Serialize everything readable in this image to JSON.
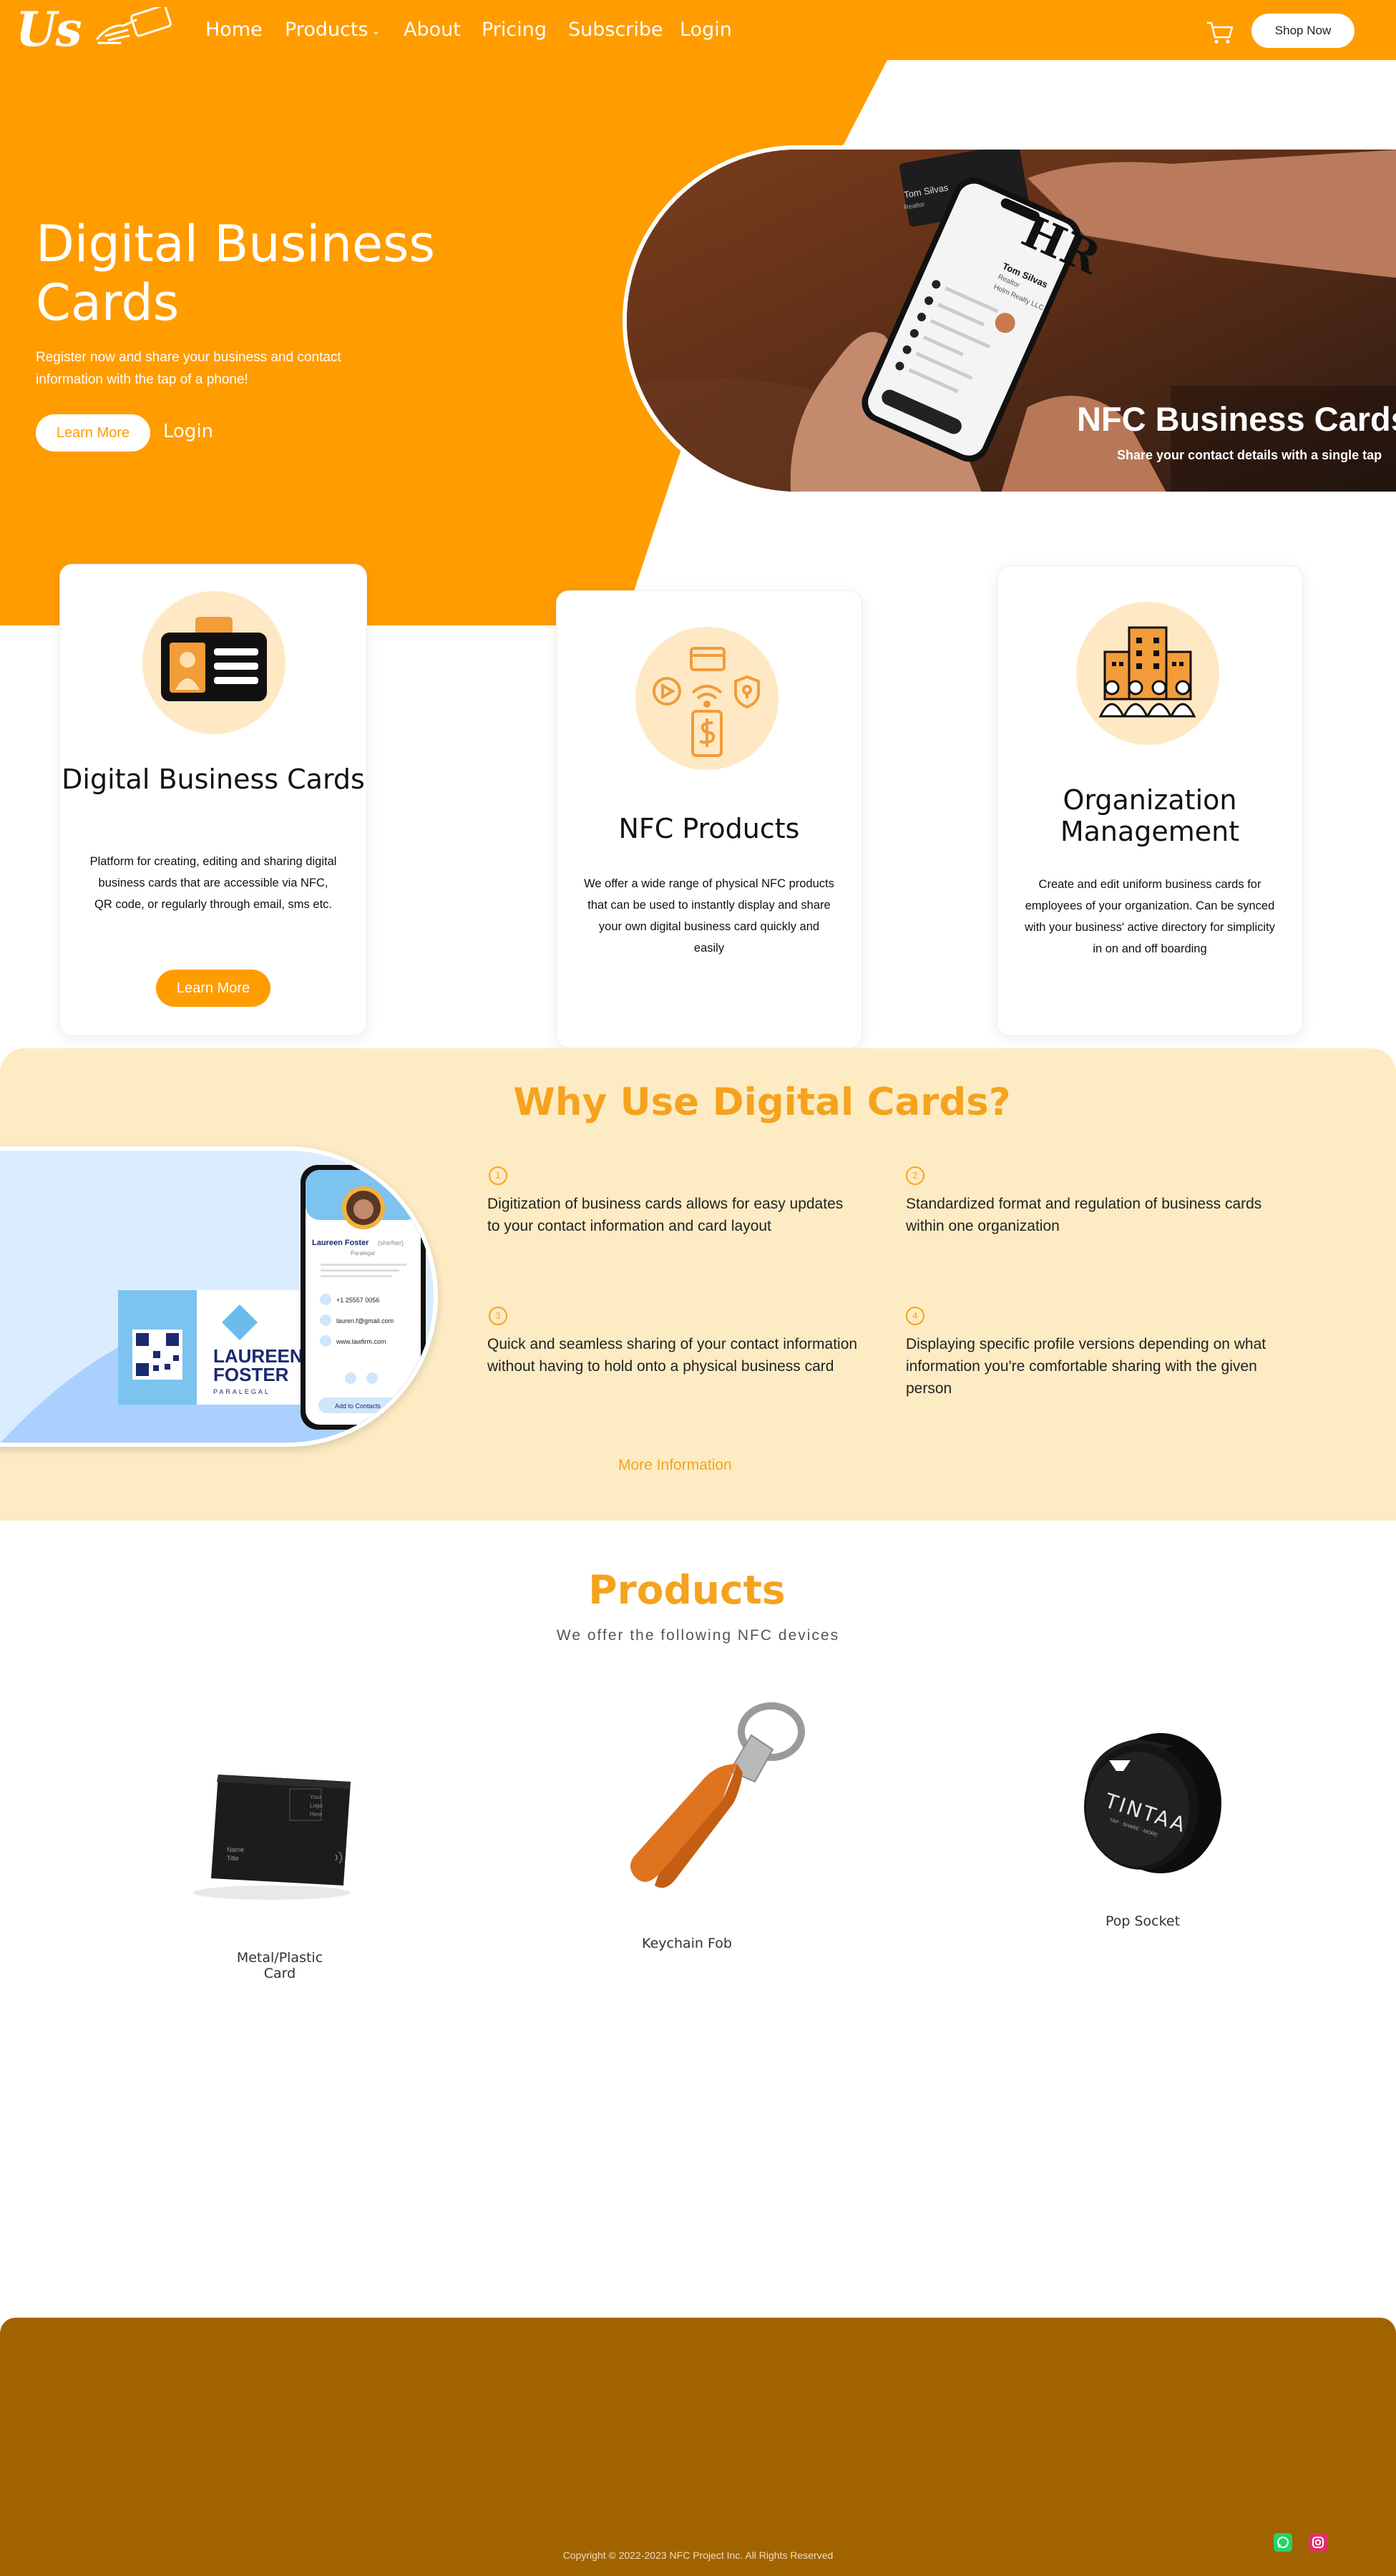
{
  "nav": {
    "logo_text": "Us",
    "links": [
      "Home",
      "Products",
      "About",
      "Pricing",
      "Subscribe",
      "Login"
    ],
    "products_chevron": "⌄",
    "shop_now": "Shop Now"
  },
  "hero": {
    "title": "Digital Business Cards",
    "subtitle": "Register now and share your business and contact information with the tap of a phone!",
    "learn_more": "Learn More",
    "login": "Login",
    "photo_caption": "NFC Business Cards",
    "photo_subcaption": "Share your contact details with a single tap",
    "phone_screen": {
      "monogram": "HR",
      "name": "Tom Silvas",
      "role": "Realtor",
      "company": "Holm Realty LLC",
      "card_name": "Tom Silvas",
      "card_role": "Realtor"
    }
  },
  "features": [
    {
      "icon": "id-badge-icon",
      "title": "Digital Business Cards",
      "description": "Platform for creating, editing and sharing digital business cards that are accessible via NFC, QR code, or regularly through email, sms etc.",
      "button": "Learn More"
    },
    {
      "icon": "nfc-products-icon",
      "title": "NFC Products",
      "description": "We offer a wide range of physical NFC products that can be used to instantly display and share your own digital business card quickly and easily"
    },
    {
      "icon": "organization-icon",
      "title": "Organization Management",
      "description": "Create and edit uniform business cards for employees of your organization. Can be synced with your business' active directory for simplicity in on and off boarding"
    }
  ],
  "why": {
    "title": "Why Use Digital Cards?",
    "image": {
      "card_first": "LAUREEN",
      "card_last": "FOSTER",
      "card_role": "PARALEGAL",
      "phone_name": "Laureen Foster",
      "phone_pronoun": "(she/her)",
      "phone_role": "Paralegal",
      "phone_rows": [
        "+1 25557 0056",
        "lauren.f@gmail.com",
        "www.lawfirm.com"
      ],
      "phone_button": "Add to Contacts"
    },
    "items": [
      {
        "num": "1",
        "text": "Digitization of business cards allows for easy updates to your contact information and card layout"
      },
      {
        "num": "2",
        "text": "Standardized format and regulation of business cards within one organization"
      },
      {
        "num": "3",
        "text": "Quick and seamless sharing of your contact information without having to hold onto a physical business card"
      },
      {
        "num": "4",
        "text": "Displaying specific profile versions depending on what information you're comfortable sharing with the given person"
      }
    ],
    "more": "More Information"
  },
  "products": {
    "title": "Products",
    "subtitle": "We offer the following NFC devices",
    "items": [
      {
        "label_line1": "Metal/Plastic",
        "label_line2": "Card",
        "card_text": [
          "Your",
          "Logo",
          "Here"
        ],
        "card_name": "Name",
        "card_title": "Title"
      },
      {
        "label_line1": "Keychain  Fob"
      },
      {
        "label_line1": "Pop Socket",
        "brand": "TINTAA",
        "brand_sub": "TAP · SHARE · MORE"
      }
    ]
  },
  "footer": {
    "copyright": "Copyright © 2022-2023 NFC Project Inc. All Rights Reserved",
    "social": [
      "whatsapp-icon",
      "instagram-icon"
    ]
  },
  "colors": {
    "brand_orange": "#ff9c00",
    "light_orange": "#fdebc4",
    "footer_brown": "#a06300",
    "accent_text": "#f5a31e"
  }
}
